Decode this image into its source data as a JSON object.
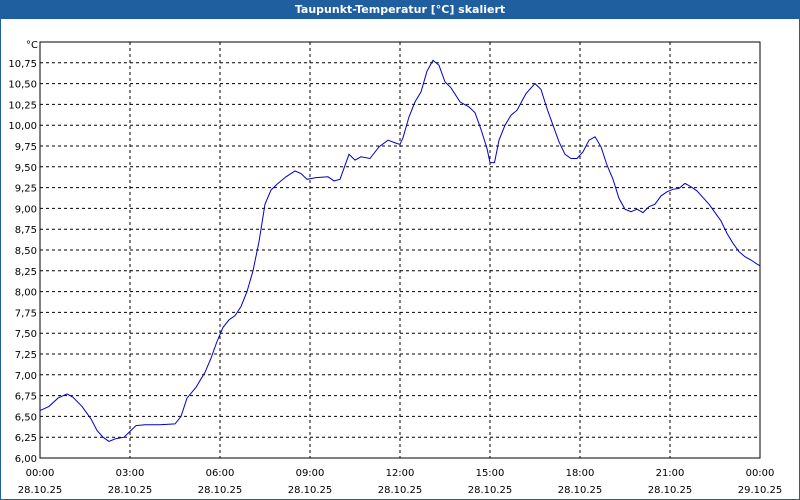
{
  "window": {
    "title": "Taupunkt-Temperatur [°C] skaliert"
  },
  "chart_data": {
    "type": "line",
    "title": "Taupunkt-Temperatur [°C] skaliert",
    "ylabel": "°C",
    "xlabel": "",
    "ylim": [
      6.0,
      11.0
    ],
    "xlim": [
      0,
      24
    ],
    "grid": true,
    "line_color": "#0000cc",
    "y_ticks": [
      "6,00",
      "6,25",
      "6,50",
      "6,75",
      "7,00",
      "7,25",
      "7,50",
      "7,75",
      "8,00",
      "8,25",
      "8,50",
      "8,75",
      "9,00",
      "9,25",
      "9,50",
      "9,75",
      "10,00",
      "10,25",
      "10,50",
      "10,75"
    ],
    "x_ticks": [
      {
        "time": "00:00",
        "date": "28.10.25"
      },
      {
        "time": "03:00",
        "date": "28.10.25"
      },
      {
        "time": "06:00",
        "date": "28.10.25"
      },
      {
        "time": "09:00",
        "date": "28.10.25"
      },
      {
        "time": "12:00",
        "date": "28.10.25"
      },
      {
        "time": "15:00",
        "date": "28.10.25"
      },
      {
        "time": "18:00",
        "date": "28.10.25"
      },
      {
        "time": "21:00",
        "date": "28.10.25"
      },
      {
        "time": "00:00",
        "date": "29.10.25"
      }
    ],
    "series": [
      {
        "points": [
          [
            0.0,
            6.57
          ],
          [
            0.3,
            6.62
          ],
          [
            0.6,
            6.72
          ],
          [
            0.9,
            6.77
          ],
          [
            1.1,
            6.73
          ],
          [
            1.4,
            6.62
          ],
          [
            1.7,
            6.47
          ],
          [
            1.9,
            6.33
          ],
          [
            2.1,
            6.25
          ],
          [
            2.3,
            6.2
          ],
          [
            2.5,
            6.23
          ],
          [
            2.8,
            6.25
          ],
          [
            3.0,
            6.32
          ],
          [
            3.2,
            6.39
          ],
          [
            3.5,
            6.4
          ],
          [
            4.0,
            6.4
          ],
          [
            4.5,
            6.41
          ],
          [
            4.7,
            6.5
          ],
          [
            4.9,
            6.72
          ],
          [
            5.2,
            6.85
          ],
          [
            5.5,
            7.03
          ],
          [
            5.7,
            7.2
          ],
          [
            5.9,
            7.4
          ],
          [
            6.1,
            7.57
          ],
          [
            6.3,
            7.66
          ],
          [
            6.5,
            7.71
          ],
          [
            6.7,
            7.82
          ],
          [
            6.9,
            8.0
          ],
          [
            7.1,
            8.25
          ],
          [
            7.3,
            8.6
          ],
          [
            7.5,
            9.05
          ],
          [
            7.7,
            9.22
          ],
          [
            7.9,
            9.29
          ],
          [
            8.2,
            9.38
          ],
          [
            8.5,
            9.45
          ],
          [
            8.7,
            9.42
          ],
          [
            8.9,
            9.35
          ],
          [
            9.2,
            9.37
          ],
          [
            9.6,
            9.38
          ],
          [
            9.8,
            9.33
          ],
          [
            10.0,
            9.35
          ],
          [
            10.3,
            9.65
          ],
          [
            10.5,
            9.58
          ],
          [
            10.7,
            9.62
          ],
          [
            11.0,
            9.6
          ],
          [
            11.3,
            9.74
          ],
          [
            11.6,
            9.82
          ],
          [
            11.9,
            9.78
          ],
          [
            12.0,
            9.77
          ],
          [
            12.1,
            9.85
          ],
          [
            12.3,
            10.1
          ],
          [
            12.5,
            10.28
          ],
          [
            12.7,
            10.4
          ],
          [
            12.9,
            10.65
          ],
          [
            13.1,
            10.78
          ],
          [
            13.3,
            10.72
          ],
          [
            13.5,
            10.52
          ],
          [
            13.7,
            10.45
          ],
          [
            14.0,
            10.28
          ],
          [
            14.3,
            10.22
          ],
          [
            14.5,
            10.15
          ],
          [
            14.7,
            9.95
          ],
          [
            14.9,
            9.72
          ],
          [
            15.0,
            9.55
          ],
          [
            15.15,
            9.55
          ],
          [
            15.3,
            9.82
          ],
          [
            15.5,
            10.0
          ],
          [
            15.7,
            10.12
          ],
          [
            15.9,
            10.18
          ],
          [
            16.2,
            10.38
          ],
          [
            16.5,
            10.5
          ],
          [
            16.7,
            10.43
          ],
          [
            16.9,
            10.2
          ],
          [
            17.1,
            10.0
          ],
          [
            17.3,
            9.8
          ],
          [
            17.5,
            9.65
          ],
          [
            17.7,
            9.6
          ],
          [
            17.9,
            9.6
          ],
          [
            18.1,
            9.68
          ],
          [
            18.3,
            9.82
          ],
          [
            18.5,
            9.86
          ],
          [
            18.7,
            9.74
          ],
          [
            18.9,
            9.52
          ],
          [
            19.1,
            9.35
          ],
          [
            19.3,
            9.12
          ],
          [
            19.5,
            8.99
          ],
          [
            19.7,
            8.96
          ],
          [
            19.9,
            8.99
          ],
          [
            20.1,
            8.95
          ],
          [
            20.3,
            9.02
          ],
          [
            20.5,
            9.05
          ],
          [
            20.7,
            9.15
          ],
          [
            20.9,
            9.2
          ],
          [
            21.1,
            9.23
          ],
          [
            21.3,
            9.24
          ],
          [
            21.5,
            9.3
          ],
          [
            21.7,
            9.26
          ],
          [
            21.9,
            9.21
          ],
          [
            22.1,
            9.13
          ],
          [
            22.3,
            9.05
          ],
          [
            22.5,
            8.95
          ],
          [
            22.7,
            8.85
          ],
          [
            22.9,
            8.7
          ],
          [
            23.1,
            8.58
          ],
          [
            23.3,
            8.48
          ],
          [
            23.5,
            8.42
          ],
          [
            23.7,
            8.38
          ],
          [
            23.9,
            8.33
          ],
          [
            24.0,
            8.31
          ]
        ]
      }
    ]
  }
}
